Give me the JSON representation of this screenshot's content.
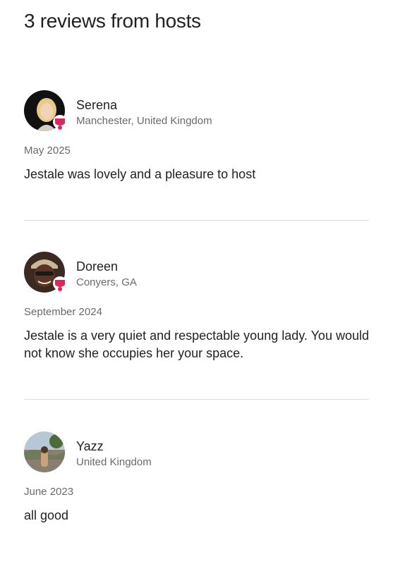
{
  "page": {
    "title": "3 reviews from hosts"
  },
  "reviews": [
    {
      "name": "Serena",
      "location": "Manchester, United Kingdom",
      "date": "May 2025",
      "text": "Jestale was lovely and a pleasure to host",
      "superhost": true
    },
    {
      "name": "Doreen",
      "location": "Conyers, GA",
      "date": "September 2024",
      "text": "Jestale is a very quiet and respectable young lady. You would not know she occupies her your space.",
      "superhost": true
    },
    {
      "name": "Yazz",
      "location": "United Kingdom",
      "date": "June 2023",
      "text": "all good",
      "superhost": false
    }
  ],
  "colors": {
    "accent": "#e0245e",
    "text": "#222222",
    "muted": "#6a6a6a",
    "divider": "#dddddd"
  }
}
